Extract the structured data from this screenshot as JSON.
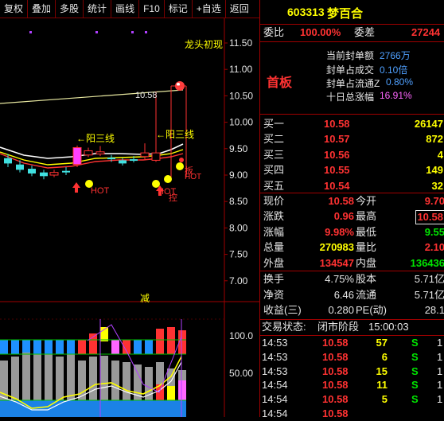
{
  "toolbar": {
    "buttons": [
      "复权",
      "叠加",
      "多股",
      "统计",
      "画线",
      "F10",
      "标记",
      "+自选",
      "返回"
    ]
  },
  "chart": {
    "price_axis": [
      "11.50",
      "11.00",
      "10.50",
      "10.00",
      "9.50",
      "9.00",
      "8.50",
      "8.00",
      "7.50",
      "7.00"
    ],
    "ind_axis": [
      "100.0",
      "50.00"
    ],
    "label_top": "龙头初现",
    "price_tag": "10.58",
    "yang_left": "←阳三线",
    "yang_right": "←阳三线",
    "hot1": "HOT",
    "hot2": "HOT",
    "mark_yellow": "减",
    "side_marks": [
      "板",
      "HOT",
      "控"
    ],
    "candles": [
      {
        "o": 9.32,
        "c": 9.22,
        "h": 9.4,
        "l": 9.15
      },
      {
        "o": 9.2,
        "c": 9.1,
        "h": 9.28,
        "l": 9.05
      },
      {
        "o": 9.12,
        "c": 9.03,
        "h": 9.18,
        "l": 8.98
      },
      {
        "o": 9.05,
        "c": 8.98,
        "h": 9.1,
        "l": 8.92
      },
      {
        "o": 9.0,
        "c": 9.05,
        "h": 9.1,
        "l": 8.96
      },
      {
        "o": 9.08,
        "c": 9.05,
        "h": 9.15,
        "l": 9.0
      },
      {
        "o": 9.2,
        "c": 9.52,
        "h": 9.56,
        "l": 9.15
      },
      {
        "o": 9.38,
        "c": 9.46,
        "h": 9.52,
        "l": 9.34
      },
      {
        "o": 9.4,
        "c": 9.44,
        "h": 9.55,
        "l": 9.36
      },
      {
        "o": 9.33,
        "c": 9.32,
        "h": 9.38,
        "l": 9.25
      },
      {
        "o": 9.28,
        "c": 9.22,
        "h": 9.32,
        "l": 9.18
      },
      {
        "o": 9.3,
        "c": 9.28,
        "h": 9.36,
        "l": 9.24
      },
      {
        "o": 9.35,
        "c": 9.42,
        "h": 9.6,
        "l": 9.3
      },
      {
        "o": 9.28,
        "c": 9.42,
        "h": 10.58,
        "l": 9.25
      }
    ]
  },
  "stock": {
    "code": "603313",
    "name": "梦百合"
  },
  "wei": {
    "wb_label": "委比",
    "wb_value": "100.00%",
    "wc_label": "委差",
    "wc_value": "27244"
  },
  "seal": {
    "badge": "首板",
    "rows": [
      {
        "label": "当前封单额",
        "value": "2766万"
      },
      {
        "label": "封单占成交",
        "value": "0.10倍"
      },
      {
        "label": "封单占流通Z",
        "value": "0.80%"
      },
      {
        "label": "十日总涨幅",
        "value": "16.91%"
      }
    ]
  },
  "buy": [
    {
      "label": "买一",
      "price": "10.58",
      "vol": "26147"
    },
    {
      "label": "买二",
      "price": "10.57",
      "vol": "872"
    },
    {
      "label": "买三",
      "price": "10.56",
      "vol": "4"
    },
    {
      "label": "买四",
      "price": "10.55",
      "vol": "149"
    },
    {
      "label": "买五",
      "price": "10.54",
      "vol": "32"
    }
  ],
  "quote": [
    {
      "l1": "现价",
      "v1": "10.58",
      "l2": "今开",
      "v2": "9.70"
    },
    {
      "l1": "涨跌",
      "v1": "0.96",
      "l2": "最高",
      "v2": "10.58"
    },
    {
      "l1": "涨幅",
      "v1": "9.98%",
      "l2": "最低",
      "v2": "9.55"
    },
    {
      "l1": "总量",
      "v1": "270983",
      "l2": "量比",
      "v2": "2.10"
    },
    {
      "l1": "外盘",
      "v1": "134547",
      "l2": "内盘",
      "v2": "136436"
    }
  ],
  "fin": [
    {
      "l1": "换手",
      "v1": "4.75%",
      "l2": "股本",
      "v2": "5.71亿"
    },
    {
      "l1": "净资",
      "v1": "6.46",
      "l2": "流通",
      "v2": "5.71亿"
    },
    {
      "l1": "收益(三)",
      "v1": "0.280",
      "l2": "PE(动)",
      "v2": "28.1"
    }
  ],
  "status": {
    "label": "交易状态:",
    "value": "闭市阶段",
    "time": "15:00:03"
  },
  "ticks": [
    {
      "t": "14:53",
      "p": "10.58",
      "v": "57",
      "d": "S",
      "n": "1"
    },
    {
      "t": "14:53",
      "p": "10.58",
      "v": "6",
      "d": "S",
      "n": "1"
    },
    {
      "t": "14:53",
      "p": "10.58",
      "v": "15",
      "d": "S",
      "n": "1"
    },
    {
      "t": "14:54",
      "p": "10.58",
      "v": "11",
      "d": "S",
      "n": "1"
    },
    {
      "t": "14:54",
      "p": "10.58",
      "v": "5",
      "d": "S",
      "n": "1"
    },
    {
      "t": "14:54",
      "p": "10.58",
      "v": "",
      "d": "",
      "n": ""
    }
  ]
}
